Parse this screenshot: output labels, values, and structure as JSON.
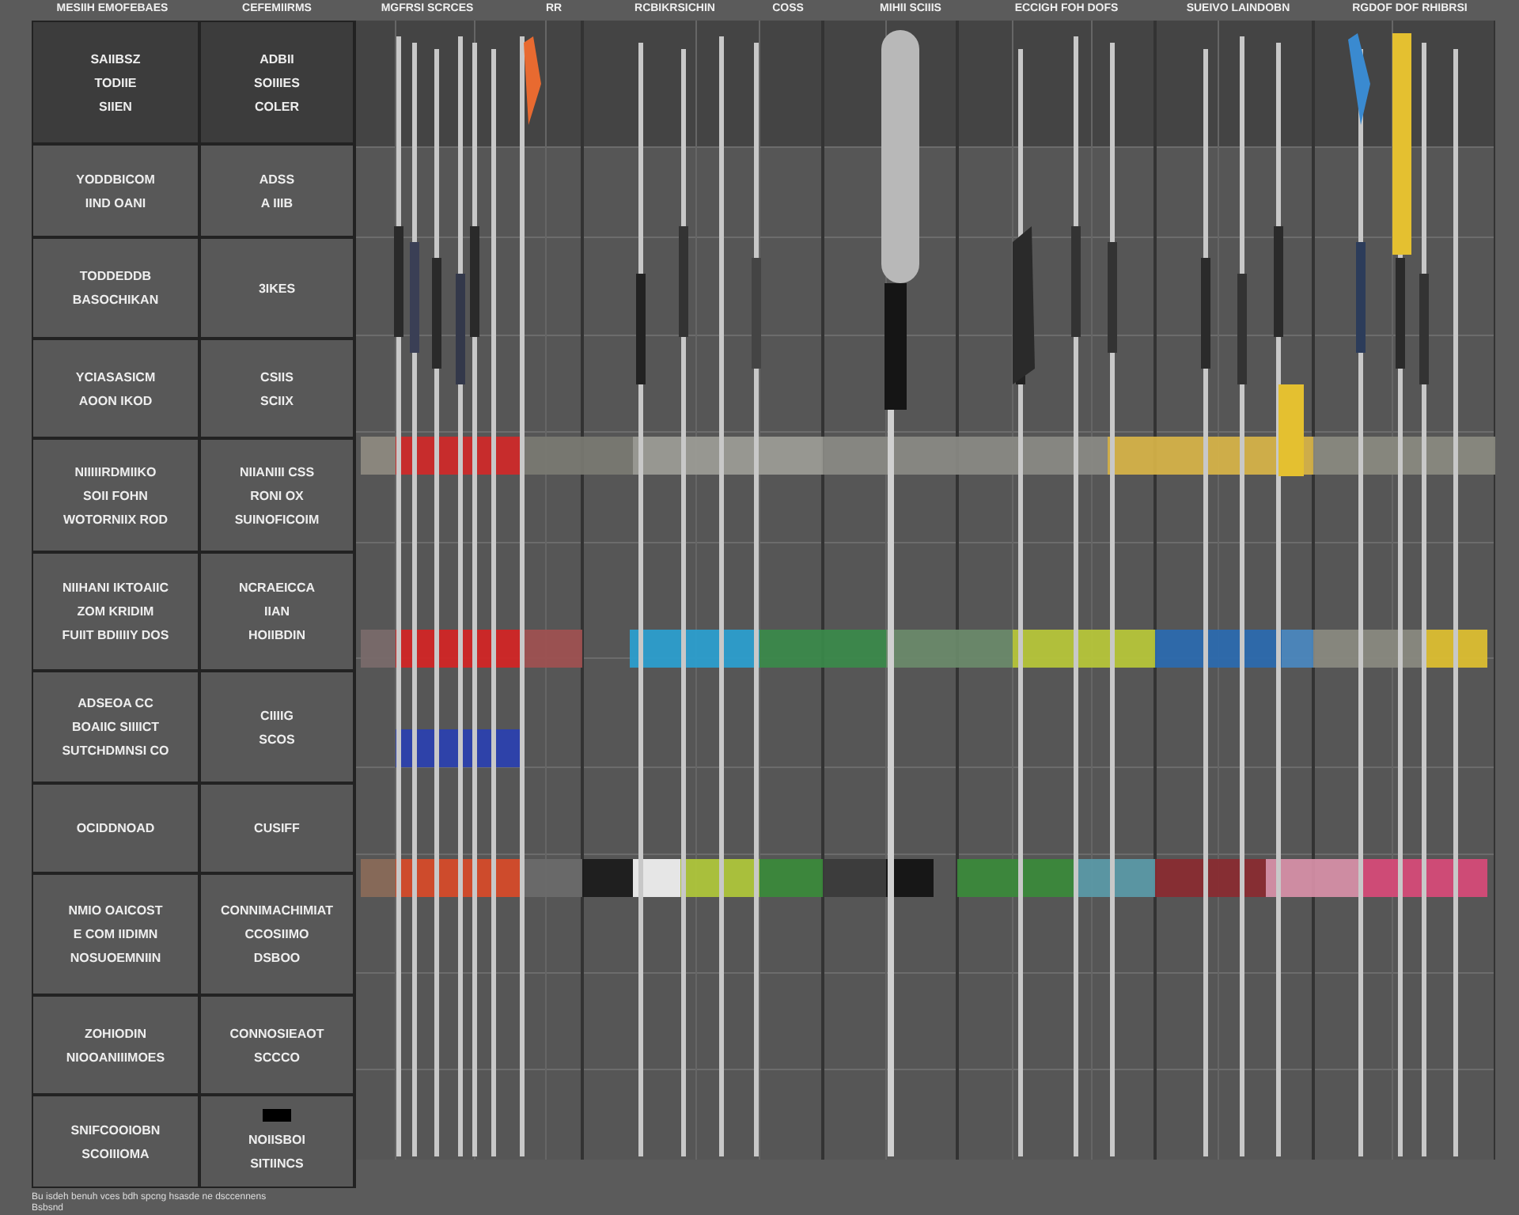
{
  "header_labels": [
    "MESIIH EMOFEBAES",
    "CEFEMIIRMS",
    "MGFRSI SCRCES",
    "RR",
    "RCBIKRSICHIN",
    "COSS",
    "MIHII SCIIIS",
    "ECCIGH FOH DOFS",
    "SUEIVO LAINDOBN",
    "RGDOF DOF RHIBRSI"
  ],
  "table": {
    "header": [
      "SAIIBSZ\nTODIIE\nSIIEN",
      "ADBII\nSOIIIES\nCOLER"
    ],
    "rows": [
      {
        "cells": [
          "YODDBICOM\nIIND OANI",
          "ADSS\nA IIIB"
        ]
      },
      {
        "cells": [
          "TODDEDDB\nBASOCHIKAN",
          "3IKES"
        ]
      },
      {
        "cells": [
          "YCIASASICM\nAOON IKOD",
          "CSIIS\nSCIIX"
        ]
      },
      {
        "cells": [
          "NIIIIIRDMIIKO\nSOII FOHN\nWOTORNIIX ROD",
          "NIIANIII CSS\nRONI OX\nSUINOFICOIM"
        ]
      },
      {
        "cells": [
          "NIIHANI IKTOAIIC\nZOM KRIDIM\nFUIIT BDIIIIY DOS",
          "NCRAEICCA\nIIAN\nHOIIBDIN"
        ]
      },
      {
        "cells": [
          "ADSEOA CC\nBOAIIC SIIIICT\nSUTCHDMNSI CO",
          "CIIIIG\nSCOS"
        ]
      },
      {
        "cells": [
          "OCIDDNOAD",
          "CUSIFF"
        ]
      },
      {
        "cells": [
          "NMIO OAICOST\nE COM IIDIMN\nNOSUOEMNIIN",
          "CONNIMACHIMIAT\nCCOSIIMO\nDSBOO"
        ]
      },
      {
        "cells": [
          "ZOHIODIN\nNIOOANIIIMOES",
          "CONNOSIEAOT\nSCCCO"
        ]
      },
      {
        "cells": [
          "SNIFCOOIOBN\nSCOIIIOMA",
          "NOIISBOI\nSITIINCS"
        ]
      }
    ]
  },
  "footer": [
    "Bu isdeh benuh vces bdh spcng hsasde ne dsccennens",
    "Bsbsnd"
  ]
}
